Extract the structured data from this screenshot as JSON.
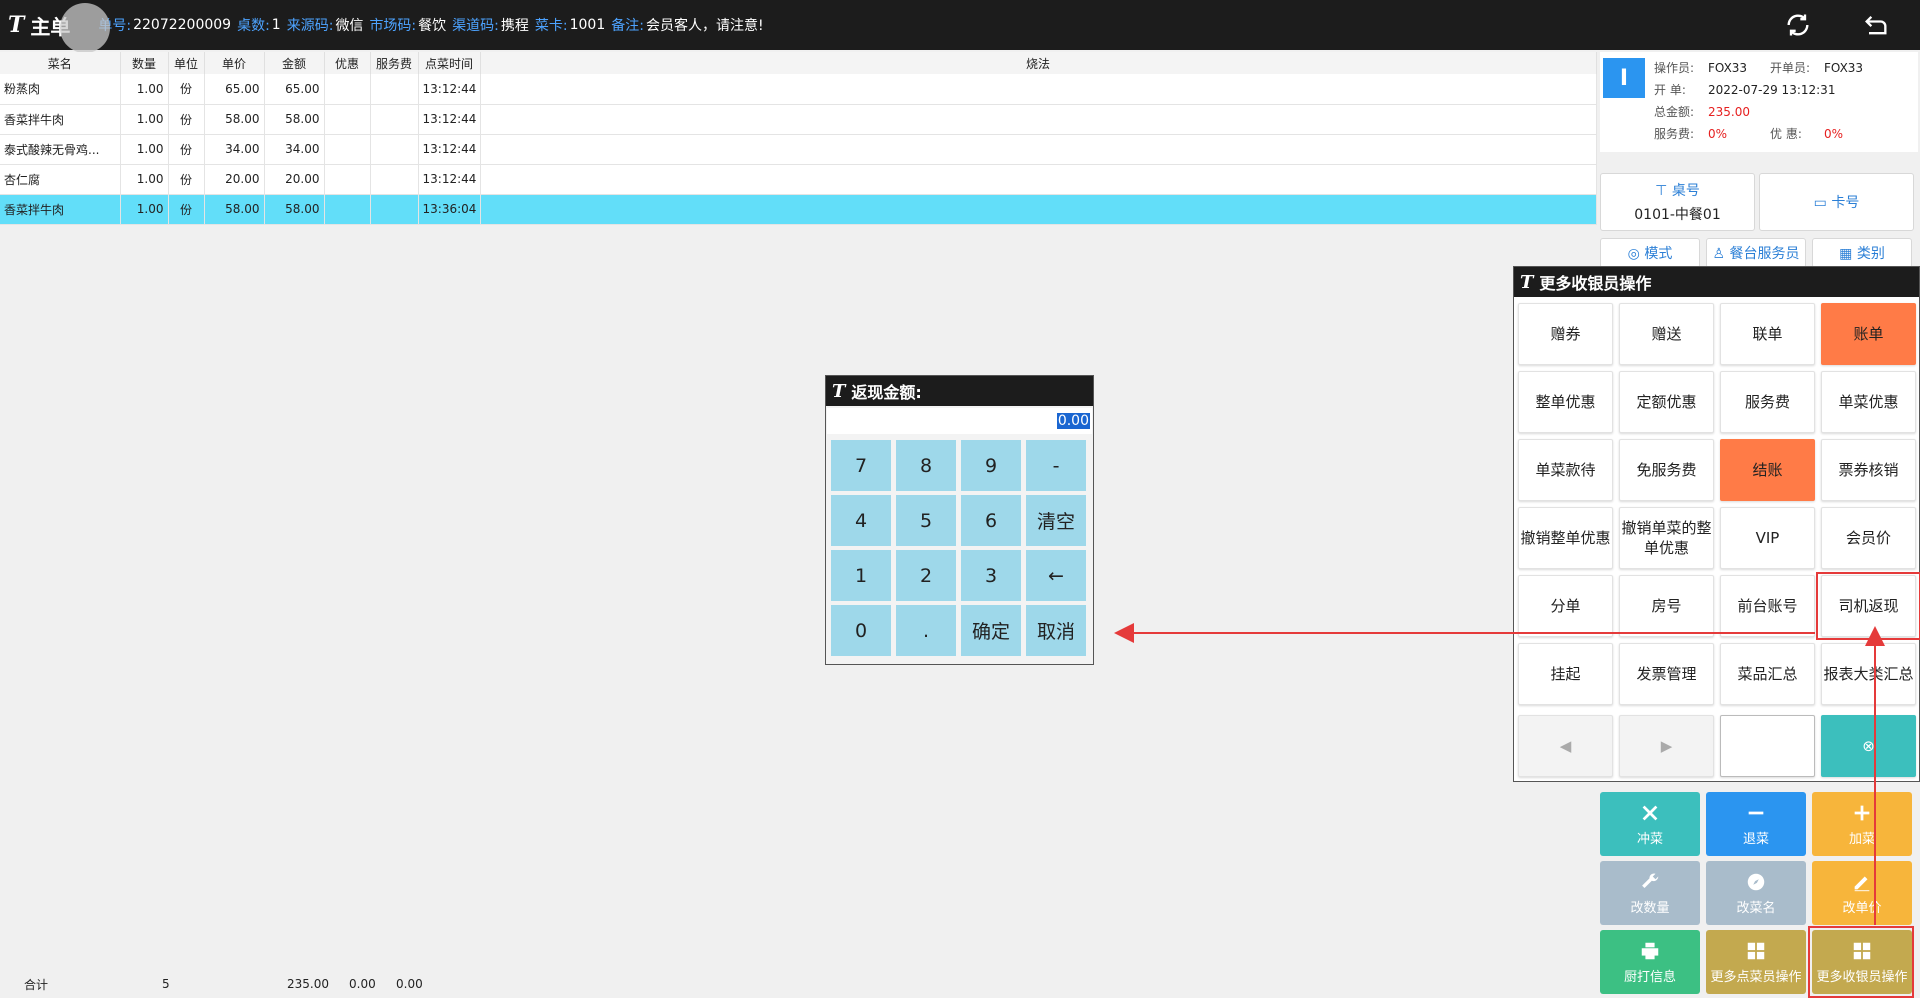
{
  "header": {
    "logo": "T",
    "title": "主单",
    "fields": [
      {
        "key": "单号:",
        "value": "22072200009"
      },
      {
        "key": "桌数:",
        "value": "1"
      },
      {
        "key": "来源码:",
        "value": "微信"
      },
      {
        "key": "市场码:",
        "value": "餐饮"
      },
      {
        "key": "渠道码:",
        "value": "携程"
      },
      {
        "key": "菜卡:",
        "value": "1001"
      },
      {
        "key": "备注:",
        "value": "会员客人，请注意!"
      }
    ],
    "icons": [
      "refresh-icon",
      "back-icon"
    ]
  },
  "table": {
    "columns": [
      "菜名",
      "数量",
      "单位",
      "单价",
      "金额",
      "优惠",
      "服务费",
      "点菜时间",
      "烧法"
    ],
    "rows": [
      {
        "name": "粉蒸肉",
        "qty": "1.00",
        "unit": "份",
        "price": "65.00",
        "amount": "65.00",
        "discount": "",
        "service": "",
        "time": "13:12:44",
        "method": ""
      },
      {
        "name": "香菜拌牛肉",
        "qty": "1.00",
        "unit": "份",
        "price": "58.00",
        "amount": "58.00",
        "discount": "",
        "service": "",
        "time": "13:12:44",
        "method": ""
      },
      {
        "name": "泰式酸辣无骨鸡...",
        "qty": "1.00",
        "unit": "份",
        "price": "34.00",
        "amount": "34.00",
        "discount": "",
        "service": "",
        "time": "13:12:44",
        "method": ""
      },
      {
        "name": "杏仁腐",
        "qty": "1.00",
        "unit": "份",
        "price": "20.00",
        "amount": "20.00",
        "discount": "",
        "service": "",
        "time": "13:12:44",
        "method": ""
      },
      {
        "name": "香菜拌牛肉",
        "qty": "1.00",
        "unit": "份",
        "price": "58.00",
        "amount": "58.00",
        "discount": "",
        "service": "",
        "time": "13:36:04",
        "method": ""
      }
    ],
    "selected_row": 4
  },
  "footer": {
    "label": "合计",
    "qty": "5",
    "amount": "235.00",
    "discount": "0.00",
    "service": "0.00"
  },
  "order_info": {
    "badge": "I",
    "operator_label": "操作员:",
    "operator": "FOX33",
    "opener_label": "开单员:",
    "opener": "FOX33",
    "open_label": "开  单:",
    "open_time": "2022-07-29 13:12:31",
    "total_label": "总金额:",
    "total": "235.00",
    "service_label": "服务费:",
    "service": "0%",
    "discount_label": "优  惠:",
    "discount": "0%"
  },
  "table_tile": {
    "label": "桌号",
    "value": "0101-中餐01"
  },
  "card_tile": {
    "label": "卡号"
  },
  "mid_tiles": [
    "模式",
    "餐台服务员",
    "类别"
  ],
  "actions": [
    {
      "label": "冲菜",
      "icon": "x-icon",
      "color": "#3cbfbd"
    },
    {
      "label": "退菜",
      "icon": "minus-icon",
      "color": "#2b95f0"
    },
    {
      "label": "加菜",
      "icon": "plus-icon",
      "color": "#f7b53b"
    },
    {
      "label": "改数量",
      "icon": "wrench-icon",
      "color": "#a9bccb"
    },
    {
      "label": "改菜名",
      "icon": "compass-icon",
      "color": "#a9bccb"
    },
    {
      "label": "改单价",
      "icon": "pencil-icon",
      "color": "#f7b53b"
    },
    {
      "label": "厨打信息",
      "icon": "printer-icon",
      "color": "#3cc083"
    },
    {
      "label": "更多点菜员操作",
      "icon": "grid-icon",
      "color": "#c3a94f"
    },
    {
      "label": "更多收银员操作",
      "icon": "grid-icon",
      "color": "#c3a94f"
    }
  ],
  "more_popup": {
    "title": "更多收银员操作",
    "buttons": [
      "赠券",
      "赠送",
      "联单",
      "账单",
      "整单优惠",
      "定额优惠",
      "服务费",
      "单菜优惠",
      "单菜款待",
      "免服务费",
      "结账",
      "票券核销",
      "撤销整单优惠",
      "撤销单菜的整单优惠",
      "VIP",
      "会员价",
      "分单",
      "房号",
      "前台账号",
      "司机返现",
      "挂起",
      "发票管理",
      "菜品汇总",
      "报表大类汇总"
    ],
    "orange_buttons": [
      "账单",
      "结账"
    ],
    "highlighted": "司机返现",
    "page_input": ""
  },
  "keypad": {
    "title": "返现金额:",
    "value": "0.00",
    "keys": [
      "7",
      "8",
      "9",
      "-",
      "4",
      "5",
      "6",
      "清空",
      "1",
      "2",
      "3",
      "←",
      "0",
      ".",
      "确定",
      "取消"
    ]
  },
  "colors": {
    "accent": "#2b95f0",
    "selected_row": "#62def9",
    "orange": "#ff7b47",
    "key": "#9ed8ea",
    "highlight": "#e53a3a"
  }
}
